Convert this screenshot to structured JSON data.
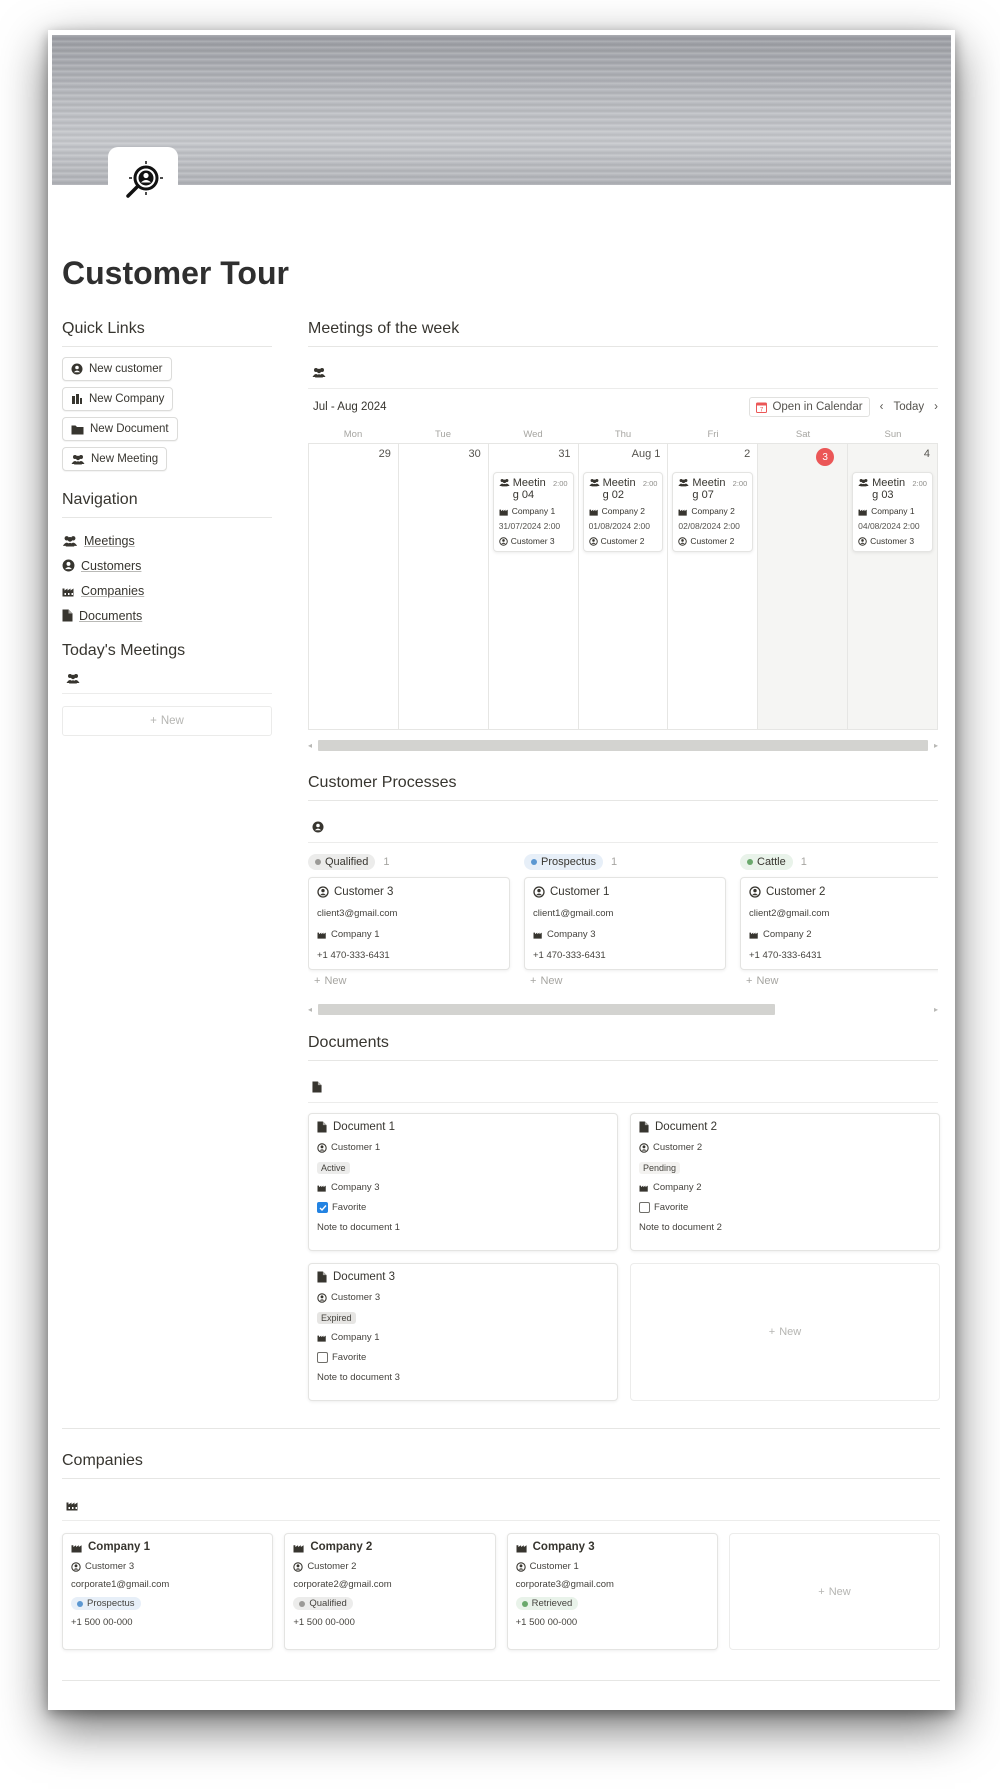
{
  "page": {
    "title": "Customer Tour",
    "icon": "magnifier-person-icon"
  },
  "quick_links": {
    "heading": "Quick Links",
    "buttons": [
      {
        "label": "New customer",
        "icon": "user-circle-icon"
      },
      {
        "label": "New Company",
        "icon": "building-icon"
      },
      {
        "label": "New Document",
        "icon": "folder-icon"
      },
      {
        "label": "New Meeting",
        "icon": "group-icon"
      }
    ]
  },
  "navigation": {
    "heading": "Navigation",
    "items": [
      {
        "label": "Meetings",
        "icon": "group-icon"
      },
      {
        "label": "Customers",
        "icon": "user-circle-icon"
      },
      {
        "label": "Companies",
        "icon": "factory-icon"
      },
      {
        "label": "Documents",
        "icon": "document-icon"
      }
    ]
  },
  "todays_meetings": {
    "heading": "Today's Meetings",
    "new_label": "New"
  },
  "meetings_week": {
    "heading": "Meetings of the week",
    "range_label": "Jul - Aug 2024",
    "open_calendar": "Open in Calendar",
    "today_label": "Today",
    "weekdays": [
      "Mon",
      "Tue",
      "Wed",
      "Thu",
      "Fri",
      "Sat",
      "Sun"
    ],
    "days": [
      {
        "num": "29"
      },
      {
        "num": "30"
      },
      {
        "num": "31",
        "event": {
          "title_a": "Meetin",
          "title_b": "g 04",
          "time": "2:00",
          "company": "Company 1",
          "date": "31/07/2024 2:00",
          "customer": "Customer 3"
        }
      },
      {
        "num": "Aug 1",
        "event": {
          "title_a": "Meetin",
          "title_b": "g 02",
          "time": "2:00",
          "company": "Company 2",
          "date": "01/08/2024 2:00",
          "customer": "Customer 2"
        }
      },
      {
        "num": "2",
        "event": {
          "title_a": "Meetin",
          "title_b": "g 07",
          "time": "2:00",
          "company": "Company 2",
          "date": "02/08/2024 2:00",
          "customer": "Customer 2"
        }
      },
      {
        "num": "3",
        "today": true
      },
      {
        "num": "4",
        "event": {
          "title_a": "Meetin",
          "title_b": "g 03",
          "time": "2:00",
          "company": "Company 1",
          "date": "04/08/2024 2:00",
          "customer": "Customer 3"
        }
      }
    ]
  },
  "customer_processes": {
    "heading": "Customer Processes",
    "new_label": "New",
    "columns": [
      {
        "status": "Qualified",
        "count": "1",
        "dot": "#9b9a97",
        "bg": "#ececeb",
        "card": {
          "name": "Customer 3",
          "email": "client3@gmail.com",
          "company": "Company 1",
          "phone": "+1 470-333-6431"
        }
      },
      {
        "status": "Prospectus",
        "count": "1",
        "dot": "#5b97d1",
        "bg": "#e7eff8",
        "card": {
          "name": "Customer 1",
          "email": "client1@gmail.com",
          "company": "Company 3",
          "phone": "+1 470-333-6431"
        }
      },
      {
        "status": "Cattle",
        "count": "1",
        "dot": "#6aa96c",
        "bg": "#e9f3ea",
        "card": {
          "name": "Customer 2",
          "email": "client2@gmail.com",
          "company": "Company 2",
          "phone": "+1 470-333-6431"
        }
      }
    ]
  },
  "documents": {
    "heading": "Documents",
    "new_label": "New",
    "favorite_label": "Favorite",
    "cards": [
      {
        "title": "Document 1",
        "customer": "Customer 1",
        "status": "Active",
        "status_bg": "#ececeb",
        "company": "Company 3",
        "favorite": true,
        "note": "Note to document 1"
      },
      {
        "title": "Document 2",
        "customer": "Customer 2",
        "status": "Pending",
        "status_bg": "#f3f2f0",
        "company": "Company 2",
        "favorite": false,
        "note": "Note to document 2"
      },
      {
        "title": "Document 3",
        "customer": "Customer 3",
        "status": "Expired",
        "status_bg": "#e6e5e3",
        "company": "Company 1",
        "favorite": false,
        "note": "Note to document 3"
      }
    ]
  },
  "companies": {
    "heading": "Companies",
    "new_label": "New",
    "cards": [
      {
        "title": "Company 1",
        "customer": "Customer 3",
        "email": "corporate1@gmail.com",
        "status": "Prospectus",
        "dot": "#5b97d1",
        "bg": "#e7eff8",
        "phone": "+1 500 00-000"
      },
      {
        "title": "Company 2",
        "customer": "Customer 2",
        "email": "corporate2@gmail.com",
        "status": "Qualified",
        "dot": "#9b9a97",
        "bg": "#ececeb",
        "phone": "+1 500 00-000"
      },
      {
        "title": "Company 3",
        "customer": "Customer 1",
        "email": "corporate3@gmail.com",
        "status": "Retrieved",
        "dot": "#6aa96c",
        "bg": "#e9f3ea",
        "phone": "+1 500 00-000"
      }
    ]
  },
  "colors": {
    "today_badge": "#eb5757",
    "checkbox_on": "#2383e2",
    "text": "#37352f"
  }
}
